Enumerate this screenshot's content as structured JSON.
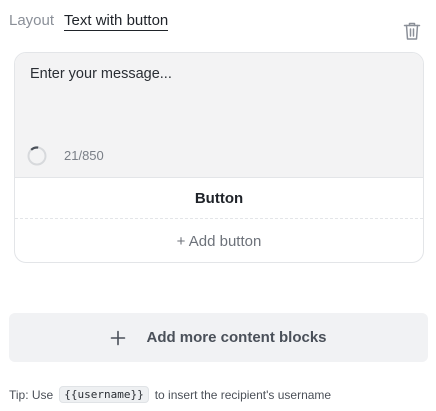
{
  "header": {
    "label": "Layout",
    "tab": "Text with button",
    "delete_icon": "trash-icon"
  },
  "message": {
    "placeholder": "Enter your message...",
    "char_count": "21/850",
    "progress_icon": "progress-ring-icon"
  },
  "card": {
    "button_label": "Button",
    "add_button_label": "+ Add button"
  },
  "add_blocks": {
    "icon": "plus-icon",
    "label": "Add more content blocks"
  },
  "tip": {
    "prefix": "Tip: Use",
    "code": "{{username}}",
    "suffix": "to insert the recipient's username"
  }
}
